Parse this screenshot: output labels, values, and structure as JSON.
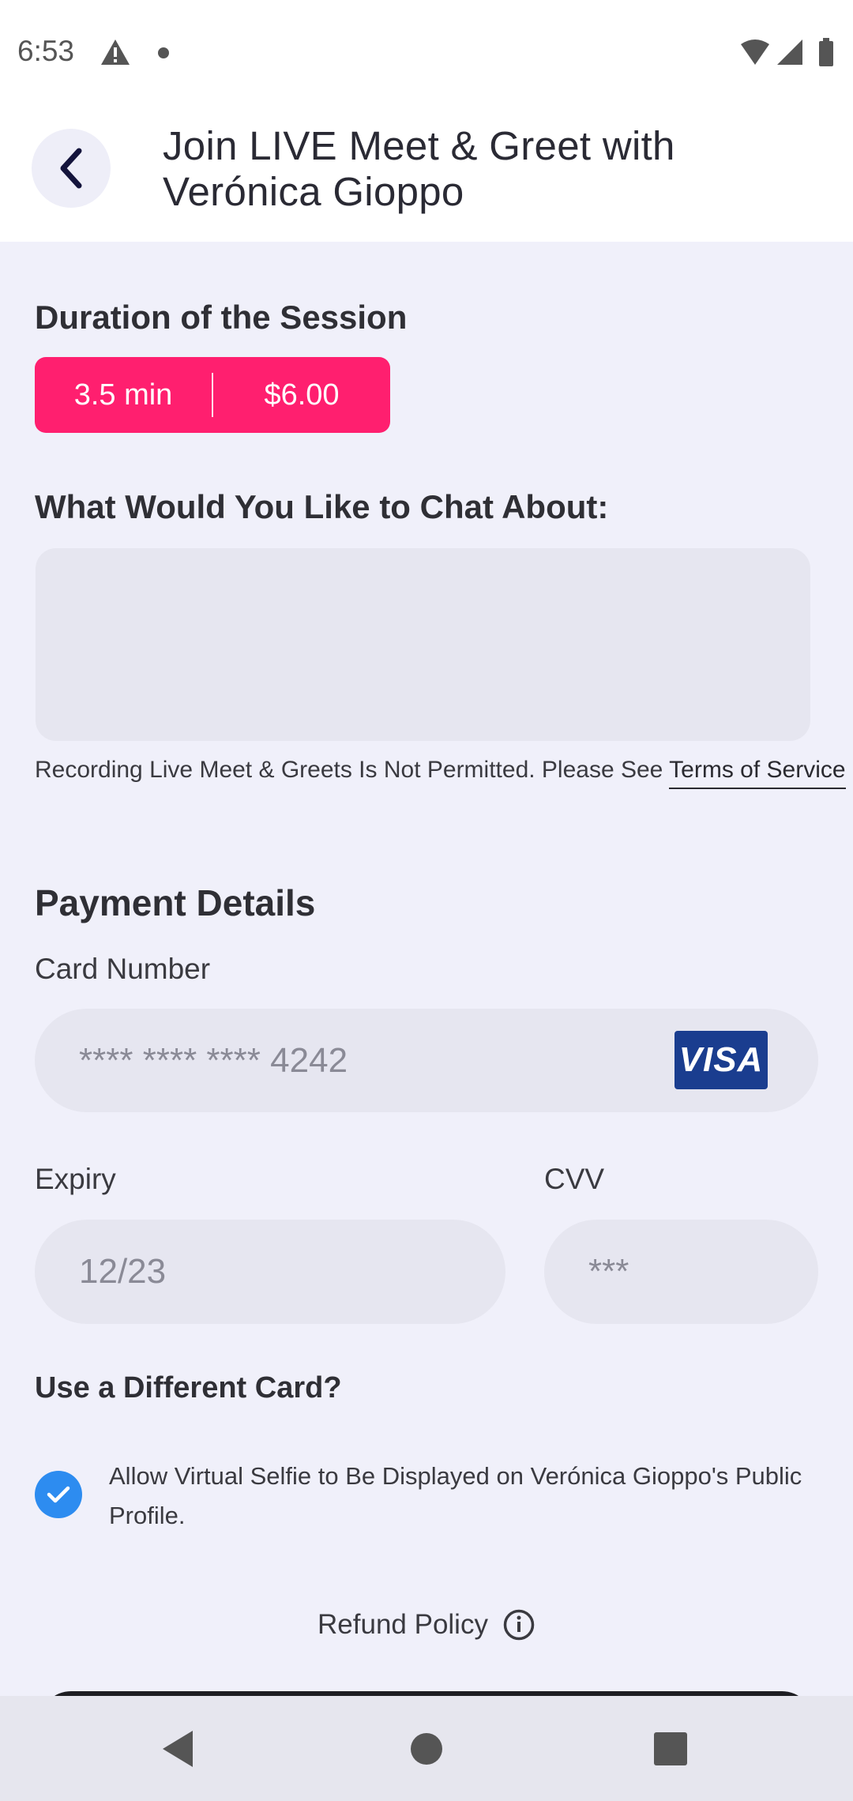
{
  "status_bar": {
    "time": "6:53"
  },
  "header": {
    "title": "Join LIVE Meet & Greet with Verónica  Gioppo"
  },
  "duration": {
    "heading": "Duration of the Session",
    "minutes": "3.5 min",
    "price": "$6.00",
    "accent_color": "#FF1F6F"
  },
  "chat": {
    "heading": "What Would You Like to Chat About:",
    "value": "",
    "notice": "Recording Live Meet & Greets Is Not Permitted. Please See",
    "terms_link": "Terms of Service"
  },
  "payment": {
    "heading": "Payment Details",
    "card_label": "Card Number",
    "card_value": "**** **** **** 4242",
    "card_brand": "VISA",
    "expiry_label": "Expiry",
    "expiry_value": "12/23",
    "cvv_label": "CVV",
    "cvv_value": "***",
    "different_card": "Use a Different Card?"
  },
  "consent": {
    "checked": true,
    "label": "Allow Virtual Selfie to Be Displayed on Verónica  Gioppo's Public Profile."
  },
  "refund": {
    "label": "Refund Policy",
    "icon": "info-icon"
  }
}
